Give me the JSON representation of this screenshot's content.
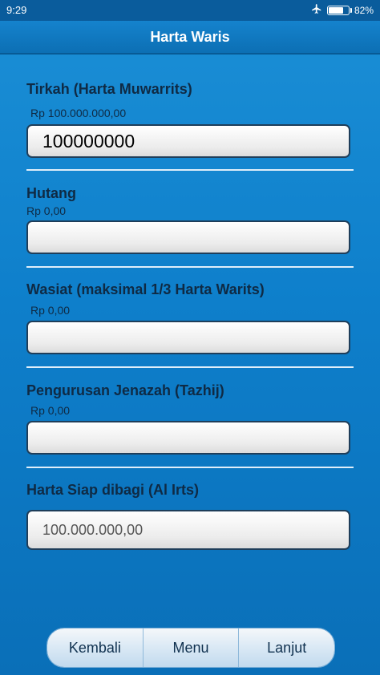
{
  "status_bar": {
    "time": "9:29",
    "battery_percent": "82%",
    "battery_level": 0.82
  },
  "titlebar": {
    "title": "Harta Waris"
  },
  "sections": {
    "tirkah": {
      "label": "Tirkah (Harta Muwarrits)",
      "amount": "Rp 100.000.000,00",
      "value": "100000000"
    },
    "hutang": {
      "label": "Hutang",
      "amount": "Rp 0,00",
      "value": ""
    },
    "wasiat": {
      "label": "Wasiat (maksimal 1/3 Harta Warits)",
      "amount": "Rp 0,00",
      "value": ""
    },
    "jenazah": {
      "label": "Pengurusan Jenazah (Tazhij)",
      "amount": "Rp 0,00",
      "value": ""
    },
    "siap": {
      "label": "Harta Siap dibagi (Al Irts)",
      "value": "100.000.000,00"
    }
  },
  "buttons": {
    "back": "Kembali",
    "menu": "Menu",
    "next": "Lanjut"
  },
  "colors": {
    "background": "#0e7fcb",
    "titlebar": "#0c6fb4",
    "status_bar": "#0a5c9c"
  }
}
